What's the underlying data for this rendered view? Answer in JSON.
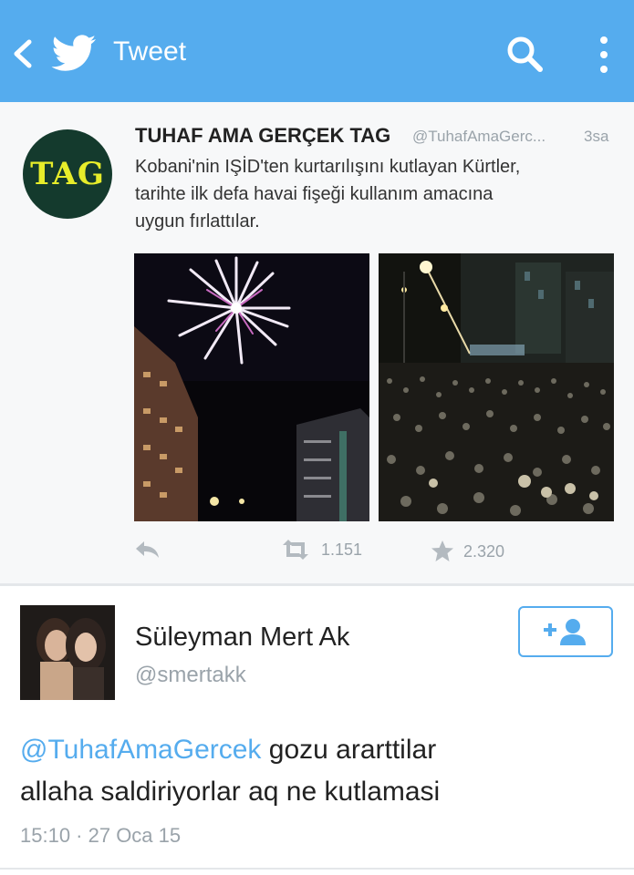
{
  "topbar": {
    "title": "Tweet",
    "back_icon": "chevron-left-icon",
    "logo_icon": "twitter-bird-icon",
    "search_icon": "search-icon",
    "menu_icon": "overflow-menu-icon",
    "background": "#55acee"
  },
  "embedded_tweet": {
    "avatar_text": "TAG",
    "author_name": "TUHAF AMA GERÇEK TAG",
    "author_handle": "@TuhafAmaGerc...",
    "time_ago": "3sa",
    "text_lines": [
      "Kobani'nin IŞİD'ten kurtarılışını kutlayan Kürtler,",
      "tarihte ilk defa havai fişeği kullanım amacına",
      "uygun fırlattılar."
    ],
    "photos": [
      "fireworks-photo",
      "crowd-photo"
    ],
    "retweets": "1.151",
    "favorites": "2.320"
  },
  "reply_tweet": {
    "user_name": "Süleyman Mert Ak",
    "user_handle": "@smertakk",
    "mention": "@TuhafAmaGercek",
    "text_first": " gozu ararttilar",
    "text_second": "allaha saldiriyorlar aq ne kutlamasi",
    "timestamp": "15:10 · 27 Oca 15",
    "follow_icon": "add-user-icon"
  },
  "colors": {
    "accent": "#55acee",
    "muted": "#9aa3aa"
  }
}
